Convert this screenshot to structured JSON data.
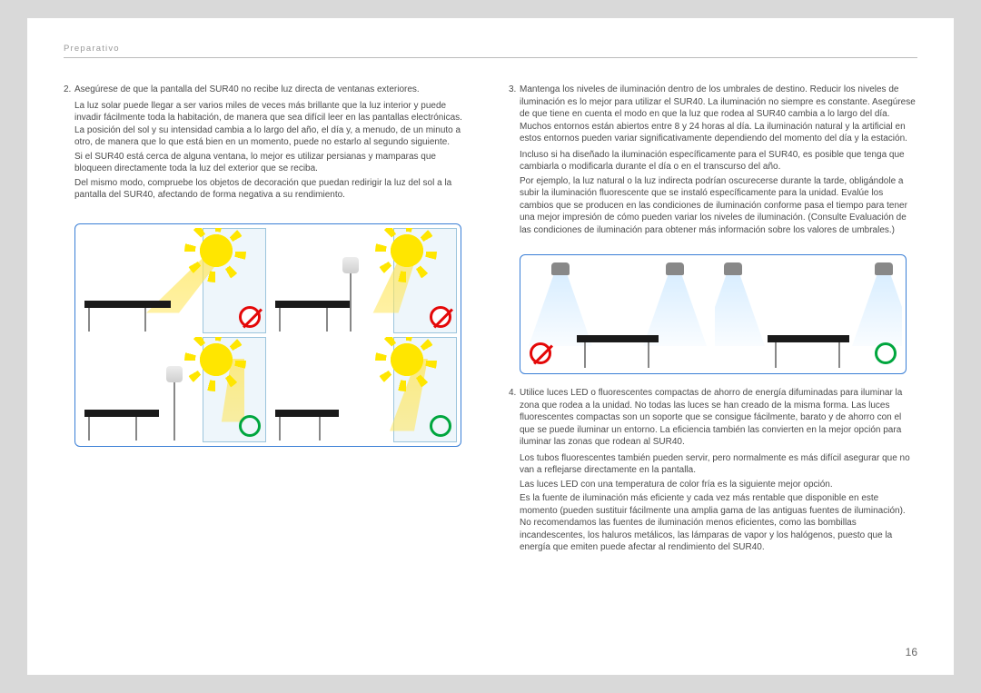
{
  "header": {
    "section": "Preparativo"
  },
  "pageNumber": "16",
  "left": {
    "item2": {
      "num": "2.",
      "lead": "Asegúrese de que la pantalla del SUR40 no recibe luz directa de ventanas exteriores.",
      "p1": "La luz solar puede llegar a ser varios miles de veces más brillante que la luz interior y puede invadir fácilmente toda la habitación, de manera que sea difícil leer en las pantallas electrónicas. La posición del sol y su intensidad cambia a lo largo del año, el día y, a menudo, de un minuto a otro, de manera que lo que está bien en un momento, puede no estarlo al segundo siguiente.",
      "p2": "Si el SUR40 está cerca de alguna ventana, lo mejor es utilizar persianas y mamparas que bloqueen directamente toda la luz del exterior que se reciba.",
      "p3": "Del mismo modo, compruebe los objetos de decoración que puedan redirigir la luz del sol a la pantalla del SUR40, afectando de forma negativa a su rendimiento."
    }
  },
  "right": {
    "item3": {
      "num": "3.",
      "lead": "Mantenga los niveles de iluminación dentro de los umbrales de destino. Reducir los niveles de iluminación es lo mejor para utilizar el SUR40. La iluminación no siempre es constante. Asegúrese de que tiene en cuenta el modo en que la luz que rodea al SUR40 cambia a lo largo del día. Muchos entornos están abiertos entre 8 y 24 horas al día. La iluminación natural y la artificial en estos entornos pueden variar significativamente dependiendo del momento del día y la estación.",
      "p1": "Incluso si ha diseñado la iluminación específicamente para el SUR40, es posible que tenga que cambiarla o modificarla durante el día o en el transcurso del año.",
      "p2": "Por ejemplo, la luz natural o la luz indirecta podrían oscurecerse durante la tarde, obligándole a subir la iluminación fluorescente que se instaló específicamente para la unidad. Evalúe los cambios que se producen en las condiciones de iluminación conforme pasa el tiempo para tener una mejor impresión de cómo pueden variar los niveles de iluminación. (Consulte Evaluación de las condiciones de iluminación para obtener más información sobre los valores de umbrales.)"
    },
    "item4": {
      "num": "4.",
      "lead": "Utilice luces LED o fluorescentes compactas de ahorro de energía difuminadas para iluminar la zona que rodea a la unidad. No todas las luces se han creado de la misma forma. Las luces fluorescentes compactas son un soporte que se consigue fácilmente, barato y de ahorro con el que se puede iluminar un entorno. La eficiencia también las convierten en la mejor opción para iluminar las zonas que rodean al SUR40.",
      "p1": "Los tubos fluorescentes también pueden servir, pero normalmente es más difícil asegurar que no van a reflejarse directamente en la pantalla.",
      "p2": "Las luces LED con una temperatura de color fría es la siguiente mejor opción.",
      "p3": "Es la fuente de iluminación más eficiente y cada vez más rentable que disponible en este momento (pueden sustituir fácilmente una amplia gama de las antiguas fuentes de iluminación). No recomendamos las fuentes de iluminación menos eficientes, como las bombillas incandescentes, los haluros metálicos, las lámparas de vapor y los halógenos, puesto que la energía que emiten puede afectar al rendimiento del SUR40."
    }
  }
}
